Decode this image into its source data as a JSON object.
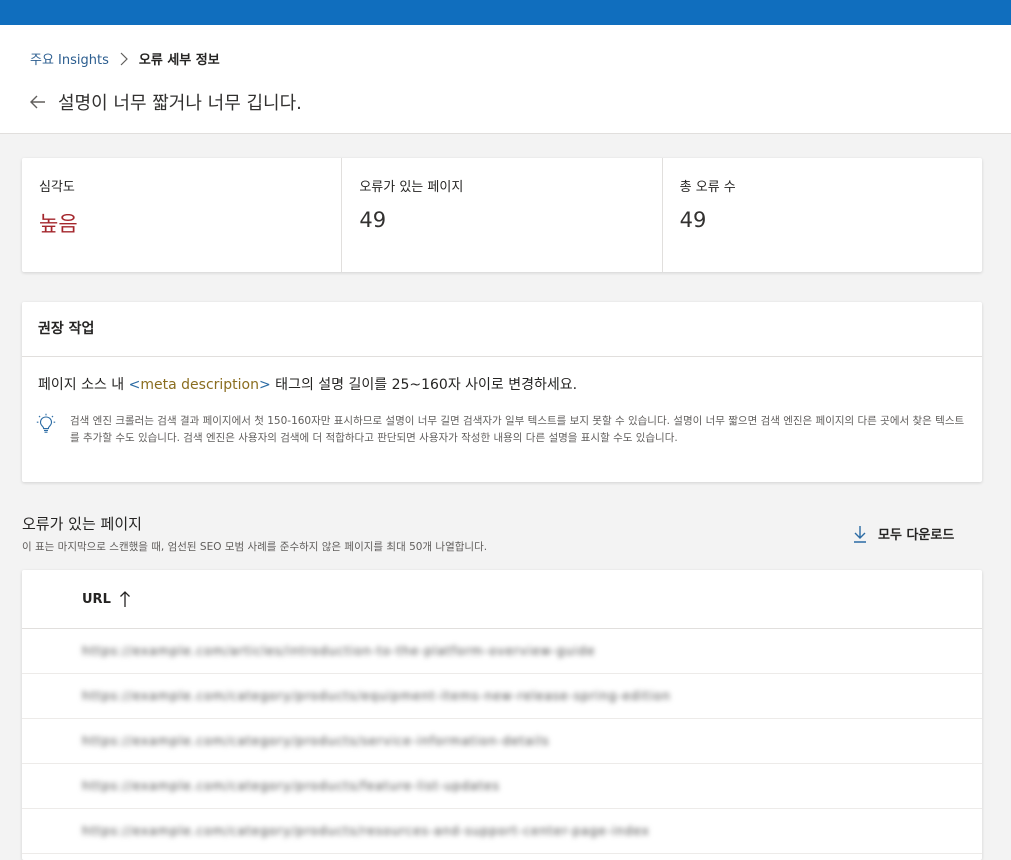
{
  "breadcrumb": {
    "parent": "주요 Insights",
    "current": "오류 세부 정보"
  },
  "page": {
    "title": "설명이 너무 짧거나 너무 깁니다."
  },
  "stats": {
    "severity_label": "심각도",
    "severity_value": "높음",
    "pages_label": "오류가 있는 페이지",
    "pages_value": "49",
    "errors_label": "총 오류 수",
    "errors_value": "49"
  },
  "recommendation": {
    "title": "권장 작업",
    "text_before": "페이지 소스 내 ",
    "code_open": "<",
    "code_tag": "meta description",
    "code_close": ">",
    "text_after": " 태그의 설명 길이를 25~160자 사이로 변경하세요.",
    "note": "검색 엔진 크롤러는 검색 결과 페이지에서 첫 150-160자만 표시하므로 설명이 너무 길면 검색자가 일부 텍스트를 보지 못할 수 있습니다. 설명이 너무 짧으면 검색 엔진은 페이지의 다른 곳에서 찾은 텍스트를 추가할 수도 있습니다. 검색 엔진은 사용자의 검색에 더 적합하다고 판단되면 사용자가 작성한 내용의 다른 설명을 표시할 수도 있습니다."
  },
  "pages_section": {
    "title": "오류가 있는 페이지",
    "description": "이 표는 마지막으로 스캔했을 때, 엄선된 SEO 모범 사례를 준수하지 않은 페이지를 최대 50개 나열합니다.",
    "download_label": "모두 다운로드"
  },
  "table": {
    "column_url": "URL",
    "rows": [
      "https://example.com/articles/introduction-to-the-platform-overview-guide",
      "https://example.com/category/products/equipment-items-new-release-spring-edition",
      "https://example.com/category/products/service-information-details",
      "https://example.com/category/products/feature-list-updates",
      "https://example.com/category/products/resources-and-support-center-page-index"
    ]
  },
  "colors": {
    "topbar": "#106ebe",
    "severity_high": "#a4262c",
    "link": "#2b5d8f"
  },
  "icons": {
    "back": "arrow-left-icon",
    "separator": "chevron-right-icon",
    "tip": "lightbulb-icon",
    "download": "download-icon",
    "sort": "arrow-up-icon"
  }
}
